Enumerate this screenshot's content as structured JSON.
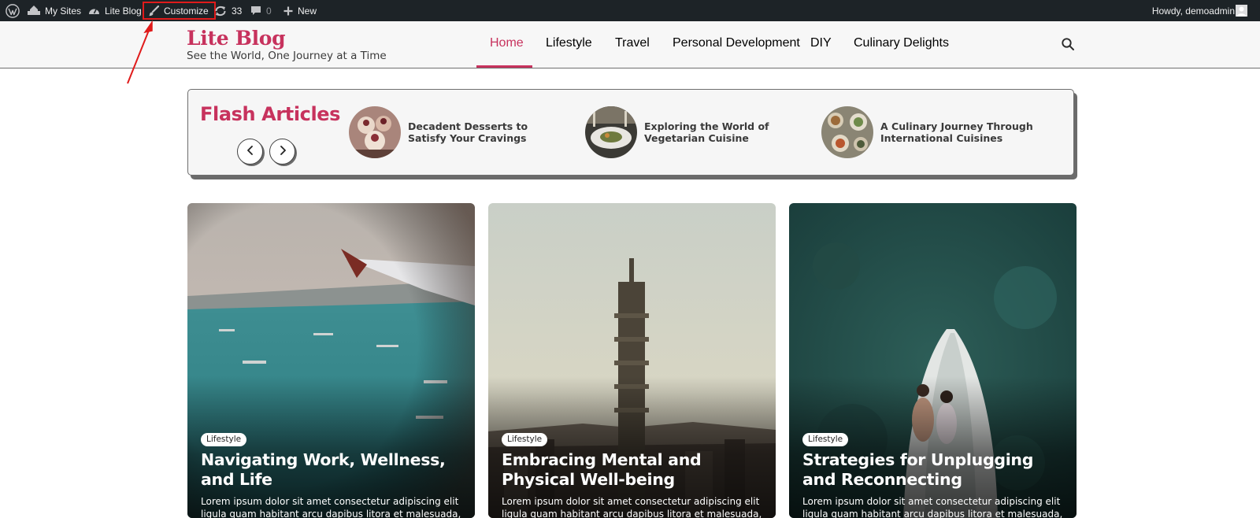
{
  "adminbar": {
    "my_sites": "My Sites",
    "site_name": "Lite Blog",
    "customize": "Customize",
    "updates_count": "33",
    "comments_count": "0",
    "new_label": "New",
    "howdy": "Howdy, demoadmin"
  },
  "header": {
    "site_title": "Lite Blog",
    "tagline": "See the World, One Journey at a Time",
    "nav": [
      "Home",
      "Lifestyle",
      "Travel",
      "Personal Development",
      "DIY",
      "Culinary Delights"
    ],
    "active_nav": "Home"
  },
  "flash": {
    "title": "Flash Articles",
    "items": [
      "Decadent Desserts to Satisfy Your Cravings",
      "Exploring the World of Vegetarian Cuisine",
      "A Culinary Journey Through International Cuisines"
    ]
  },
  "cards": [
    {
      "category": "Lifestyle",
      "title": "Navigating Work, Wellness, and Life",
      "excerpt": "Lorem ipsum dolor sit amet consectetur adipiscing elit ligula quam habitant arcu dapibus litora et malesuada, vel"
    },
    {
      "category": "Lifestyle",
      "title": "Embracing Mental and Physical Well-being",
      "excerpt": "Lorem ipsum dolor sit amet consectetur adipiscing elit ligula quam habitant arcu dapibus litora et malesuada, vel"
    },
    {
      "category": "Lifestyle",
      "title": "Strategies for Unplugging and Reconnecting",
      "excerpt": "Lorem ipsum dolor sit amet consectetur adipiscing elit ligula quam habitant arcu dapibus litora et malesuada, vel"
    }
  ],
  "colors": {
    "accent": "#c7325d",
    "adminbar_bg": "#1d2327",
    "highlight_box": "#e01b1b"
  },
  "icons": {
    "wordpress": "wordpress-logo-icon",
    "my_sites": "my-sites-icon",
    "site": "dashboard-gauge-icon",
    "customize": "paintbrush-icon",
    "updates": "refresh-icon",
    "comments": "speech-bubble-icon",
    "new": "plus-icon",
    "search": "search-icon",
    "prev": "chevron-left-icon",
    "next": "chevron-right-icon"
  }
}
